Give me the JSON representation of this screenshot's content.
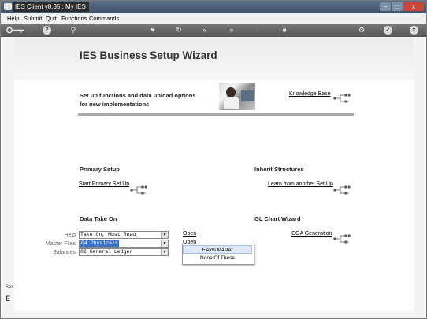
{
  "window": {
    "title": "IES Client v8.35 : My IES",
    "minimize": "–",
    "maximize": "□",
    "close": "x"
  },
  "menu": [
    "Help",
    "Submit",
    "Quit",
    "Functions",
    "Commands"
  ],
  "toolbar": {
    "icons": [
      "key-icon",
      "help-icon",
      "search-icon",
      "heart-icon",
      "refresh-icon",
      "rewind-icon",
      "forward-icon",
      "upload-icon",
      "stop-icon",
      "settings-icon",
      "check-icon",
      "close-icon"
    ],
    "help_glyph": "?",
    "search_glyph": "⚲",
    "heart_glyph": "♥",
    "refresh_glyph": "↻",
    "rewind_glyph": "«",
    "forward_glyph": "»",
    "upload_glyph": "↑",
    "stop_glyph": "■",
    "settings_glyph": "⚙",
    "check_glyph": "✓",
    "close_glyph": "x"
  },
  "wizard": {
    "title": "IES Business Setup Wizard",
    "intro_line1": "Set up functions and data upload options",
    "intro_line2": "for new implementations.",
    "knowledge_base": "Knowledge Base"
  },
  "primary_setup": {
    "heading": "Primary Setup",
    "link": "Start Primary Set Up"
  },
  "inherit": {
    "heading": "Inherit Structures",
    "link": "Learn from another Set Up"
  },
  "data_take_on": {
    "heading": "Data Take On",
    "rows": [
      {
        "label": "Help",
        "value": "Take On, Must Read"
      },
      {
        "label": "Master Files",
        "value": "04 Physicals"
      },
      {
        "label": "Balances",
        "value": "02 General Ledger"
      }
    ],
    "open1": "Open",
    "open2": "Open"
  },
  "gl_chart": {
    "heading": "GL Chart Wizard",
    "link": "COA Generation"
  },
  "popup": {
    "item1": "Fields Master",
    "item2": "None Of These"
  },
  "left_strip": {
    "text": "Ses",
    "glyph": "E"
  },
  "colors": {
    "titlebar": "#3e5068",
    "toolbar": "#555555",
    "selection": "#3a73c8"
  }
}
